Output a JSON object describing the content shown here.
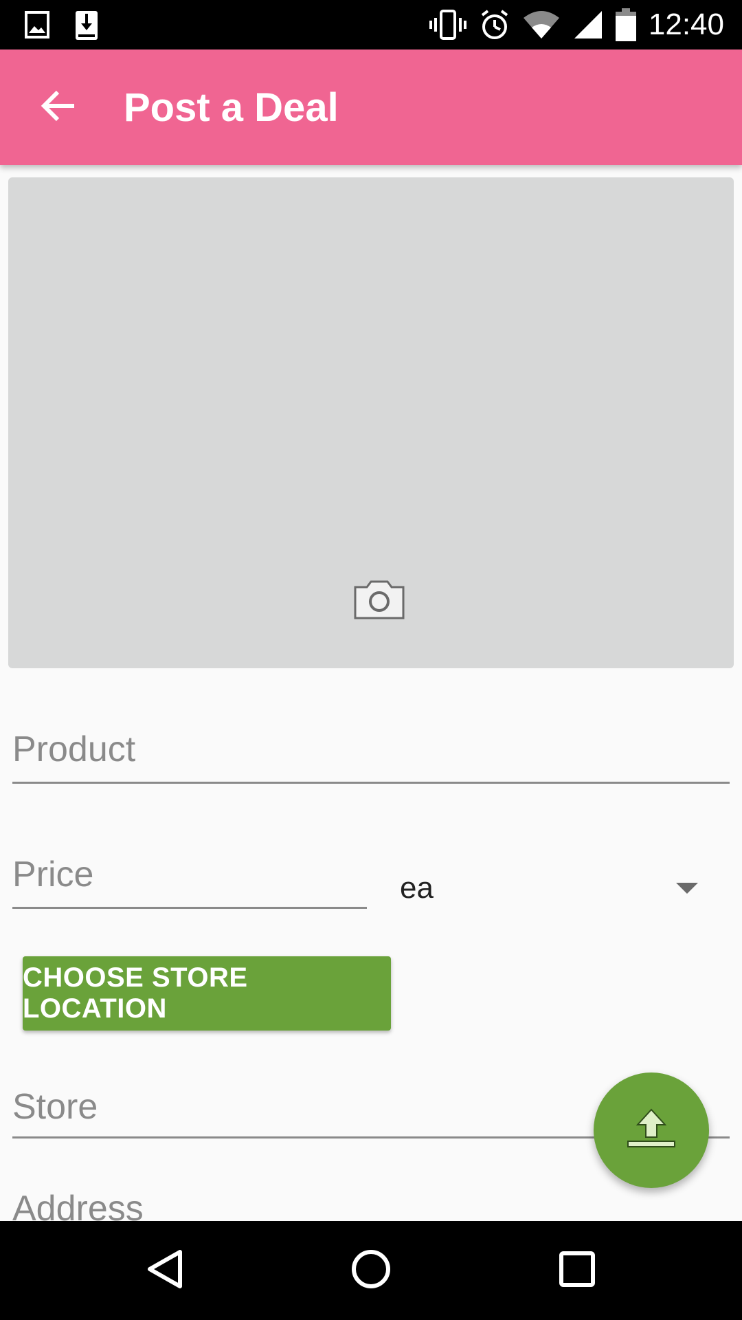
{
  "status_bar": {
    "time": "12:40",
    "left_icons": [
      "image-icon",
      "download-icon"
    ],
    "right_icons": [
      "vibrate-icon",
      "alarm-icon",
      "wifi-icon",
      "signal-icon",
      "battery-icon"
    ]
  },
  "app_bar": {
    "title": "Post a Deal",
    "back_icon": "arrow-back-icon",
    "background": "#f06592"
  },
  "photo": {
    "icon": "camera-icon"
  },
  "form": {
    "product_placeholder": "Product",
    "price_placeholder": "Price",
    "unit_value": "ea",
    "choose_store_label": "CHOOSE STORE LOCATION",
    "store_placeholder": "Store",
    "address_placeholder": "Address"
  },
  "fab": {
    "icon": "upload-icon",
    "color": "#6aa23a"
  },
  "nav_bar": {
    "icons": [
      "back-triangle-icon",
      "home-circle-icon",
      "recents-square-icon"
    ]
  }
}
